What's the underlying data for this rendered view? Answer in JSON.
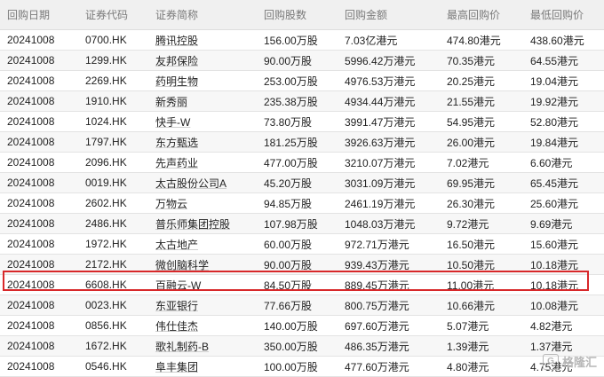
{
  "headers": [
    "回购日期",
    "证券代码",
    "证券简称",
    "回购股数",
    "回购金额",
    "最高回购价",
    "最低回购价"
  ],
  "rows": [
    [
      "20241008",
      "0700.HK",
      "腾讯控股",
      "156.00万股",
      "7.03亿港元",
      "474.80港元",
      "438.60港元"
    ],
    [
      "20241008",
      "1299.HK",
      "友邦保险",
      "90.00万股",
      "5996.42万港元",
      "70.35港元",
      "64.55港元"
    ],
    [
      "20241008",
      "2269.HK",
      "药明生物",
      "253.00万股",
      "4976.53万港元",
      "20.25港元",
      "19.04港元"
    ],
    [
      "20241008",
      "1910.HK",
      "新秀丽",
      "235.38万股",
      "4934.44万港元",
      "21.55港元",
      "19.92港元"
    ],
    [
      "20241008",
      "1024.HK",
      "快手-W",
      "73.80万股",
      "3991.47万港元",
      "54.95港元",
      "52.80港元"
    ],
    [
      "20241008",
      "1797.HK",
      "东方甄选",
      "181.25万股",
      "3926.63万港元",
      "26.00港元",
      "19.84港元"
    ],
    [
      "20241008",
      "2096.HK",
      "先声药业",
      "477.00万股",
      "3210.07万港元",
      "7.02港元",
      "6.60港元"
    ],
    [
      "20241008",
      "0019.HK",
      "太古股份公司A",
      "45.20万股",
      "3031.09万港元",
      "69.95港元",
      "65.45港元"
    ],
    [
      "20241008",
      "2602.HK",
      "万物云",
      "94.85万股",
      "2461.19万港元",
      "26.30港元",
      "25.60港元"
    ],
    [
      "20241008",
      "2486.HK",
      "普乐师集团控股",
      "107.98万股",
      "1048.03万港元",
      "9.72港元",
      "9.69港元"
    ],
    [
      "20241008",
      "1972.HK",
      "太古地产",
      "60.00万股",
      "972.71万港元",
      "16.50港元",
      "15.60港元"
    ],
    [
      "20241008",
      "2172.HK",
      "微创脑科学",
      "90.00万股",
      "939.43万港元",
      "10.50港元",
      "10.18港元"
    ],
    [
      "20241008",
      "6608.HK",
      "百融云-W",
      "84.50万股",
      "889.45万港元",
      "11.00港元",
      "10.18港元"
    ],
    [
      "20241008",
      "0023.HK",
      "东亚银行",
      "77.66万股",
      "800.75万港元",
      "10.66港元",
      "10.08港元"
    ],
    [
      "20241008",
      "0856.HK",
      "伟仕佳杰",
      "140.00万股",
      "697.60万港元",
      "5.07港元",
      "4.82港元"
    ],
    [
      "20241008",
      "1672.HK",
      "歌礼制药-B",
      "350.00万股",
      "486.35万港元",
      "1.39港元",
      "1.37港元"
    ],
    [
      "20241008",
      "0546.HK",
      "阜丰集团",
      "100.00万股",
      "477.60万港元",
      "4.80港元",
      "4.75港元"
    ]
  ],
  "highlight_row_index": 12,
  "highlight_color": "#d8282a",
  "watermark": {
    "text": "格隆汇",
    "icon": "glh-logo-icon"
  }
}
